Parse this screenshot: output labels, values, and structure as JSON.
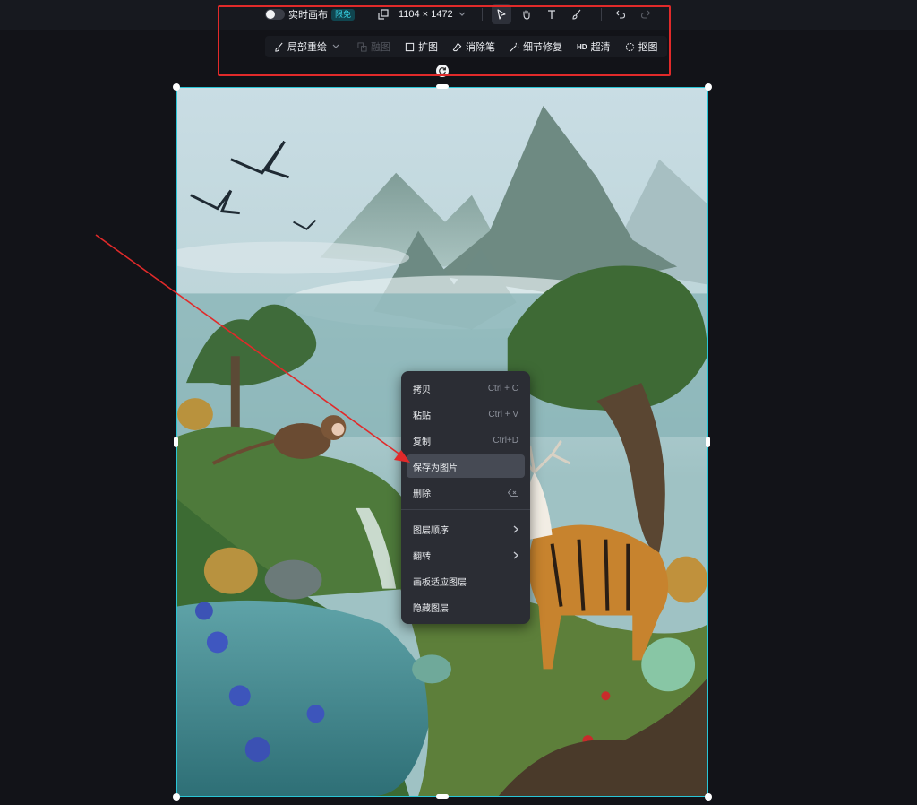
{
  "toolbar": {
    "realtime_canvas_label": "实时画布",
    "limited_free_badge": "限免",
    "canvas_size": "1104 × 1472",
    "tools": [
      {
        "label": "局部重绘"
      },
      {
        "label": "融图"
      },
      {
        "label": "扩图"
      },
      {
        "label": "消除笔"
      },
      {
        "label": "细节修复"
      },
      {
        "label": "超清",
        "prefix": "HD"
      },
      {
        "label": "抠图"
      }
    ]
  },
  "context_menu": {
    "items": [
      {
        "label": "拷贝",
        "shortcut": "Ctrl + C"
      },
      {
        "label": "粘贴",
        "shortcut": "Ctrl + V"
      },
      {
        "label": "复制",
        "shortcut": "Ctrl+D"
      },
      {
        "label": "保存为图片",
        "hovered": true
      },
      {
        "label": "删除",
        "shortcut_icon": "backspace-icon"
      },
      {
        "label": "图层顺序",
        "submenu": true
      },
      {
        "label": "翻转",
        "submenu": true
      },
      {
        "label": "画板适应图层"
      },
      {
        "label": "隐藏图层"
      }
    ]
  },
  "colors": {
    "selection": "#29c5d6",
    "highlight_box": "#e12a2a",
    "arrow": "#e12a2a",
    "badge": "#38d6e8"
  }
}
